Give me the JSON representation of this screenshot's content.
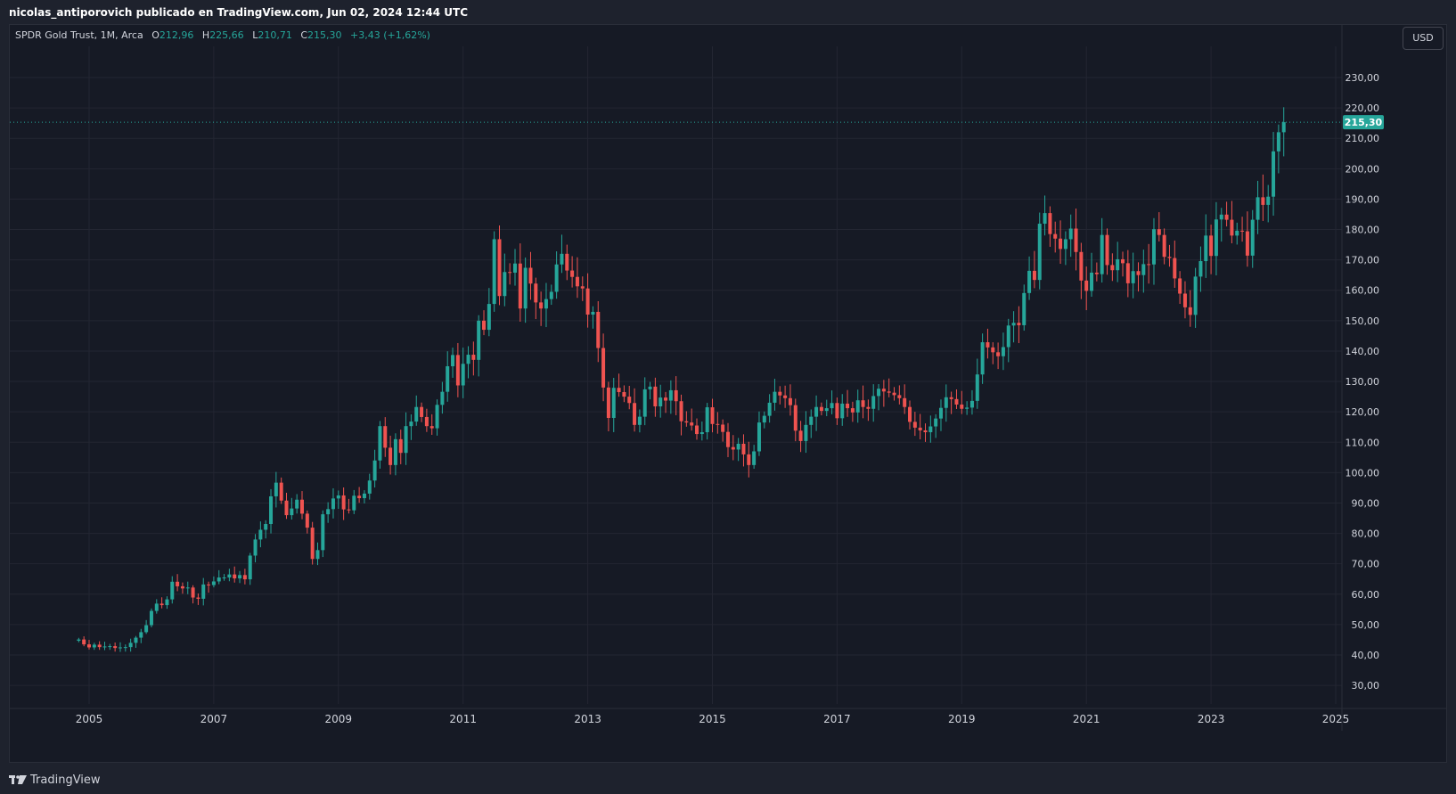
{
  "header": {
    "attribution": "nicolas_antiporovich publicado en TradingView.com, Jun 02, 2024 12:44 UTC"
  },
  "legend": {
    "symbol": "SPDR Gold Trust, 1M, Arca",
    "o_label": "O",
    "o_value": "212,96",
    "h_label": "H",
    "h_value": "225,66",
    "l_label": "L",
    "l_value": "210,71",
    "c_label": "C",
    "c_value": "215,30",
    "change": "+3,43 (+1,62%)"
  },
  "currency_button": "USD",
  "footer": {
    "brand": "TradingView"
  },
  "colors": {
    "up": "#26a69a",
    "down": "#ef5350",
    "background": "#161a25",
    "grid": "#232632",
    "text": "#d1d4dc"
  },
  "chart_data": {
    "type": "candlestick",
    "title": "SPDR Gold Trust, 1M, Arca",
    "xlabel": "",
    "ylabel": "",
    "x_ticks": [
      "2005",
      "2007",
      "2009",
      "2011",
      "2013",
      "2015",
      "2017",
      "2019",
      "2021",
      "2023",
      "2025"
    ],
    "y_ticks": [
      "30,00",
      "40,00",
      "50,00",
      "60,00",
      "70,00",
      "80,00",
      "90,00",
      "100,00",
      "110,00",
      "120,00",
      "130,00",
      "140,00",
      "150,00",
      "160,00",
      "170,00",
      "180,00",
      "190,00",
      "200,00",
      "210,00",
      "220,00",
      "230,00"
    ],
    "ylim": [
      24,
      240
    ],
    "last_price": 215.3,
    "last_price_label": "215,30",
    "start": "2004-11",
    "closes": [
      45.1,
      43.5,
      42.5,
      43.4,
      42.6,
      42.8,
      42.9,
      42.3,
      42.5,
      42.6,
      44.0,
      45.7,
      47.5,
      49.8,
      54.5,
      56.9,
      56.4,
      58.3,
      64.1,
      62.6,
      61.9,
      62.2,
      58.9,
      58.5,
      63.2,
      63.0,
      64.2,
      65.5,
      65.5,
      66.5,
      65.2,
      66.3,
      64.9,
      72.7,
      78.0,
      81.2,
      83.1,
      92.2,
      96.7,
      90.8,
      86.0,
      88.2,
      91.1,
      86.5,
      81.9,
      71.6,
      74.5,
      86.3,
      88.0,
      91.5,
      92.5,
      87.9,
      87.6,
      92.4,
      91.6,
      93.1,
      97.4,
      104.0,
      115.3,
      108.2,
      102.5,
      111.0,
      106.5,
      115.3,
      116.8,
      121.6,
      118.3,
      115.3,
      114.6,
      122.3,
      126.6,
      135.0,
      138.7,
      128.7,
      135.8,
      138.8,
      137.1,
      150.0,
      147.0,
      155.5,
      176.8,
      158.1,
      166.0,
      165.8,
      168.8,
      154.0,
      167.4,
      162.2,
      156.0,
      154.0,
      157.1,
      159.5,
      168.5,
      172.0,
      166.5,
      164.4,
      161.3,
      160.6,
      152.0,
      152.9,
      141.0,
      128.0,
      118.0,
      127.9,
      126.5,
      125.0,
      122.9,
      115.7,
      118.4,
      127.4,
      128.3,
      121.8,
      124.7,
      123.7,
      127.1,
      123.5,
      116.9,
      116.5,
      115.5,
      112.7,
      113.3,
      121.5,
      116.0,
      115.8,
      113.4,
      108.4,
      107.6,
      109.5,
      106.0,
      102.5,
      107.0,
      116.5,
      118.7,
      123.0,
      126.6,
      125.4,
      124.5,
      122.2,
      113.8,
      110.4,
      115.7,
      118.4,
      121.6,
      120.3,
      121.2,
      122.9,
      117.9,
      122.7,
      121.2,
      119.8,
      123.8,
      121.6,
      121.0,
      125.2,
      127.6,
      126.7,
      126.3,
      125.5,
      124.5,
      121.6,
      116.7,
      114.8,
      113.9,
      113.3,
      115.2,
      117.8,
      121.3,
      124.8,
      124.2,
      122.4,
      121.0,
      121.4,
      123.6,
      132.3,
      142.9,
      141.2,
      139.6,
      138.3,
      141.3,
      148.4,
      149.3,
      148.5,
      159.1,
      166.4,
      163.4,
      181.9,
      185.4,
      178.5,
      177.0,
      173.6,
      176.8,
      180.3,
      172.6,
      163.2,
      159.8,
      165.8,
      165.3,
      178.2,
      168.3,
      166.6,
      170.2,
      168.9,
      162.3,
      166.3,
      165.0,
      168.6,
      168.5,
      180.1,
      178.2,
      171.0,
      170.6,
      163.9,
      158.9,
      154.4,
      151.9,
      164.5,
      169.6,
      178.0,
      171.3,
      183.3,
      184.9,
      183.2,
      178.0,
      179.6,
      179.4,
      171.4,
      183.2,
      190.6,
      188.1,
      190.8,
      205.7,
      212.0,
      215.3
    ],
    "ohlc_note": "monthly candles; close of each month listed in order starting 2004-11"
  }
}
